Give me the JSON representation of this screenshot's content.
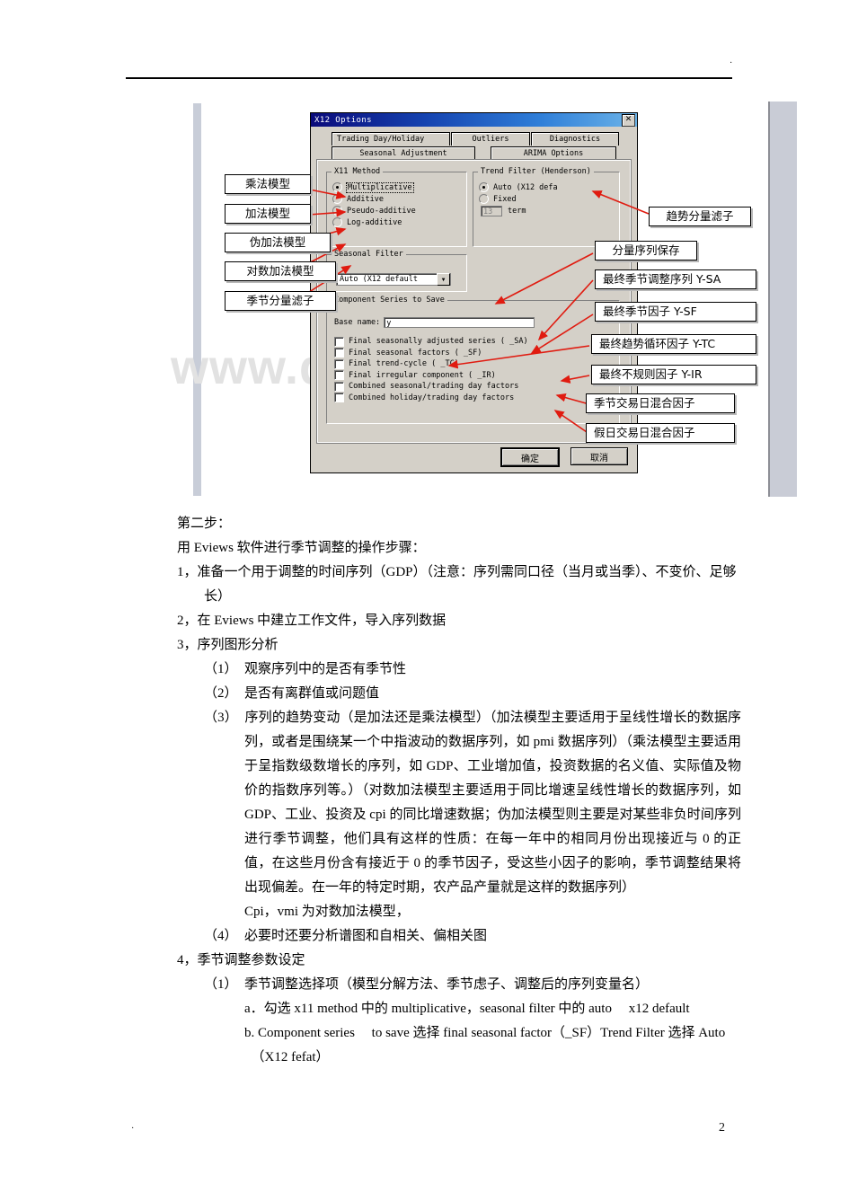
{
  "page": {
    "header_mark": "·",
    "footer_mark": "·",
    "page_number": "2",
    "watermark": "www.docin.com"
  },
  "dialog": {
    "title": "X12 Options",
    "close_icon": "✕",
    "tabs_row1": [
      {
        "label": "Trading Day/Holiday",
        "active": false
      },
      {
        "label": "Outliers",
        "active": false
      },
      {
        "label": "Diagnostics",
        "active": false
      }
    ],
    "tabs_row2": [
      {
        "label": "Seasonal Adjustment",
        "active": true
      },
      {
        "label": "ARIMA Options",
        "active": false
      }
    ],
    "x11_method": {
      "legend": "X11 Method",
      "options": [
        {
          "label": "Multiplicative",
          "selected": true
        },
        {
          "label": "Additive",
          "selected": false
        },
        {
          "label": "Pseudo-additive",
          "selected": false
        },
        {
          "label": "Log-additive",
          "selected": false
        }
      ]
    },
    "seasonal_filter": {
      "legend": "Seasonal Filter",
      "value": "Auto (X12 default",
      "arrow_icon": "▼"
    },
    "trend_filter": {
      "legend": "Trend Filter  (Henderson)",
      "options": [
        {
          "label": "Auto (X12 defa",
          "selected": true
        },
        {
          "label": "Fixed",
          "selected": false
        }
      ],
      "term_value": "13",
      "term_label": "term"
    },
    "component_series": {
      "legend": "Component Series to Save",
      "base_name_label": "Base name:",
      "base_name_value": "y",
      "checkboxes": [
        {
          "label": "Final seasonally adjusted series ( _SA)",
          "checked": false
        },
        {
          "label": "Final seasonal factors ( _SF)",
          "checked": false
        },
        {
          "label": "Final trend-cycle ( _TC)",
          "checked": false
        },
        {
          "label": "Final irregular component ( _IR)",
          "checked": false
        },
        {
          "label": "Combined seasonal/trading day factors",
          "checked": false
        },
        {
          "label": "Combined holiday/trading day factors",
          "checked": false
        }
      ]
    },
    "buttons": {
      "ok": "确定",
      "cancel": "取消"
    }
  },
  "annotations": {
    "left": [
      "乘法模型",
      "加法模型",
      "伪加法模型",
      "对数加法模型",
      "季节分量滤子"
    ],
    "right": [
      "趋势分量滤子",
      "分量序列保存",
      "最终季节调整序列 Y-SA",
      "最终季节因子 Y-SF",
      "最终趋势循环因子 Y-TC",
      "最终不规则因子 Y-IR",
      "季节交易日混合因子",
      "假日交易日混合因子"
    ]
  },
  "document": {
    "lines": [
      {
        "text": "第二步：",
        "style": "lvl0"
      },
      {
        "text": "用 Eviews 软件进行季节调整的操作步骤：",
        "style": "lvl0"
      },
      {
        "text": "1，准备一个用于调整的时间序列（GDP）（注意：序列需同口径（当月或当季）、不变价、足够长）",
        "style": "hang1"
      },
      {
        "text": "2，在 Eviews 中建立工作文件，导入序列数据",
        "style": "hang1"
      },
      {
        "text": "3，序列图形分析",
        "style": "hang1"
      },
      {
        "text": "（1）　观察序列中的是否有季节性",
        "style": "hang2"
      },
      {
        "text": "（2）　是否有离群值或问题值",
        "style": "hang2"
      },
      {
        "text": "（3）　序列的趋势变动（是加法还是乘法模型）（加法模型主要适用于呈线性增长的数据序列，或者是围绕某一个中指波动的数据序列，如 pmi 数据序列）（乘法模型主要适用于呈指数级数增长的序列，如 GDP、工业增加值，投资数据的名义值、实际值及物价的指数序列等。）（对数加法模型主要适用于同比增速呈线性增长的数据序列，如 GDP、工业、投资及 cpi 的同比增速数据；伪加法模型则主要是对某些非负时间序列进行季节调整，他们具有这样的性质：在每一年中的相同月份出现接近与 0 的正值，在这些月份含有接近于 0 的季节因子，受这些小因子的影响，季节调整结果将出现偏差。在一年的特定时期，农产品产量就是这样的数据序列）",
        "style": "hang2 just"
      },
      {
        "text": "Cpi，vmi 为对数加法模型，",
        "style": "lvl2b"
      },
      {
        "text": "（4）　必要时还要分析谱图和自相关、偏相关图",
        "style": "hang2"
      },
      {
        "text": "4，季节调整参数设定",
        "style": "hang1"
      },
      {
        "text": "（1）　季节调整选择项（模型分解方法、季节虑子、调整后的序列变量名）",
        "style": "hang2"
      },
      {
        "text": "a．勾选 x11 method 中的 multiplicative，seasonal filter 中的 auto　 x12 default",
        "style": "lvl2b"
      },
      {
        "text": "b. Component series 　to save 选择 final seasonal factor（_SF）Trend Filter 选择 Auto 　（X12 fefat）",
        "style": "lvl2b"
      }
    ]
  }
}
